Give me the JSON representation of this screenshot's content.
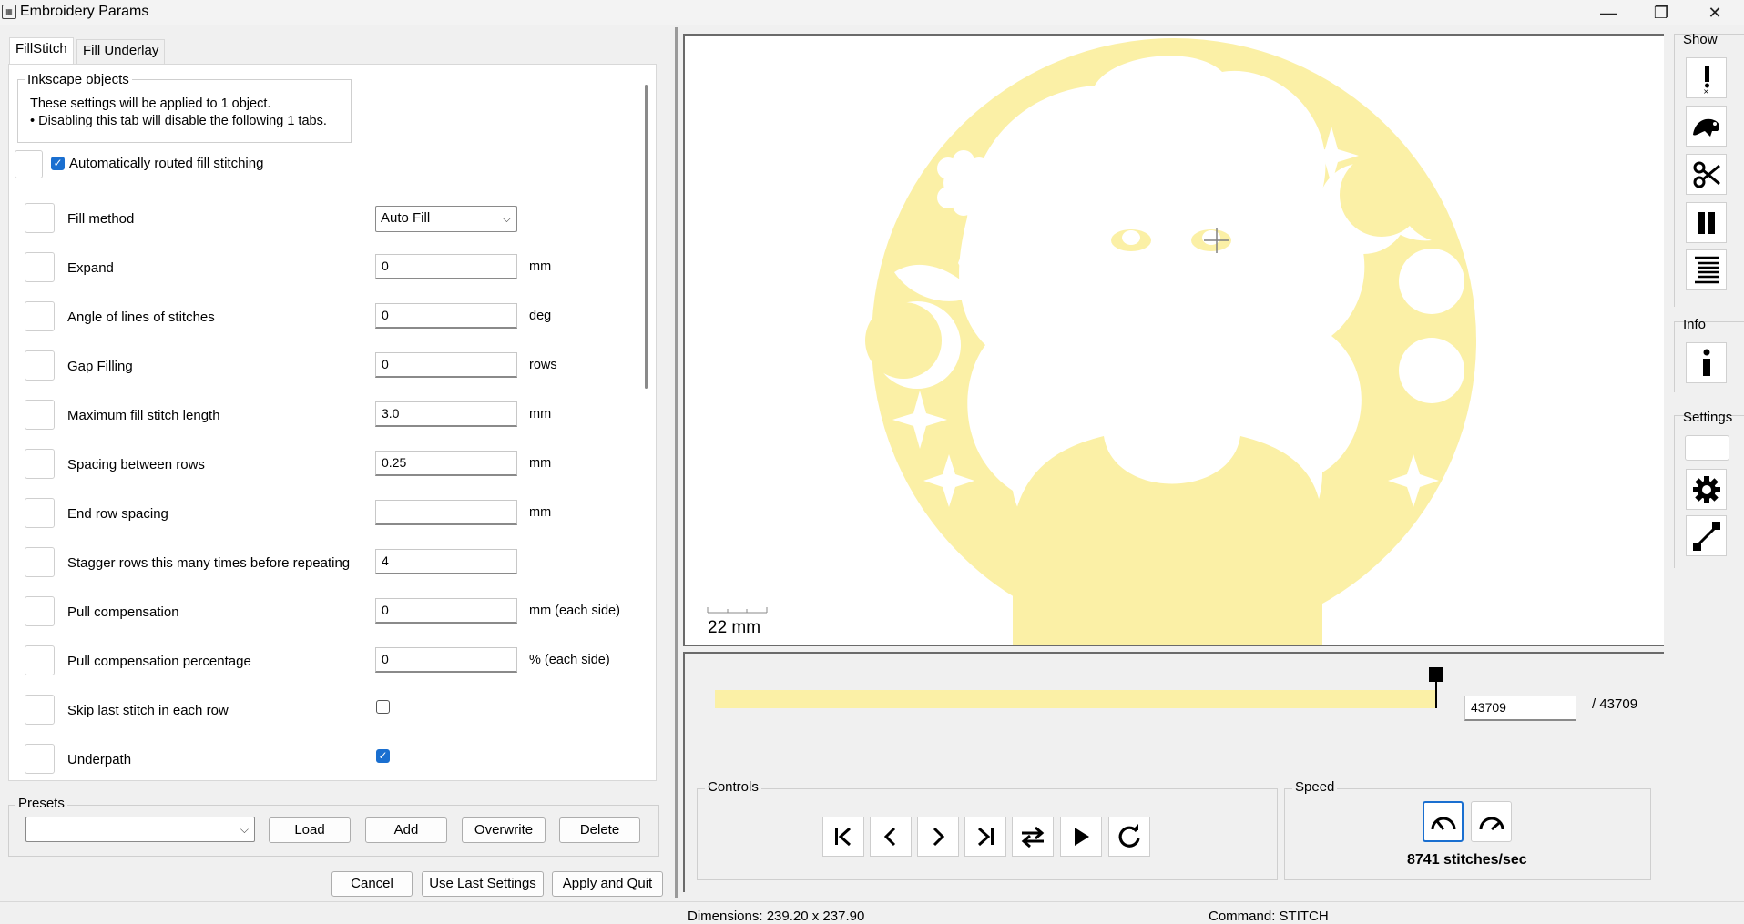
{
  "window": {
    "title": "Embroidery Params",
    "app_icon": "embroidery-app-icon",
    "minimize_icon": "minimize-icon",
    "maximize_icon": "restore-icon",
    "close_icon": "close-icon"
  },
  "tabs": [
    {
      "label": "FillStitch",
      "active": true
    },
    {
      "label": "Fill Underlay",
      "active": false
    }
  ],
  "inkscape_objects": {
    "title": "Inkscape objects",
    "line1": "These settings will be applied to 1 object.",
    "line2": "• Disabling this tab will disable the following 1 tabs."
  },
  "auto_route": {
    "label": "Automatically routed fill stitching",
    "checked": true
  },
  "params": [
    {
      "label": "Fill method",
      "type": "select",
      "value": "Auto Fill",
      "unit": ""
    },
    {
      "label": "Expand",
      "type": "text",
      "value": "0",
      "unit": "mm"
    },
    {
      "label": "Angle of lines of stitches",
      "type": "text",
      "value": "0",
      "unit": "deg"
    },
    {
      "label": "Gap Filling",
      "type": "text",
      "value": "0",
      "unit": "rows"
    },
    {
      "label": "Maximum fill stitch length",
      "type": "text",
      "value": "3.0",
      "unit": "mm"
    },
    {
      "label": "Spacing between rows",
      "type": "text",
      "value": "0.25",
      "unit": "mm"
    },
    {
      "label": "End row spacing",
      "type": "text",
      "value": "",
      "unit": "mm"
    },
    {
      "label": "Stagger rows this many times before repeating",
      "type": "text",
      "value": "4",
      "unit": ""
    },
    {
      "label": "Pull compensation",
      "type": "text",
      "value": "0",
      "unit": "mm (each side)"
    },
    {
      "label": "Pull compensation percentage",
      "type": "text",
      "value": "0",
      "unit": "% (each side)"
    },
    {
      "label": "Skip last stitch in each row",
      "type": "checkbox",
      "checked": false,
      "unit": ""
    },
    {
      "label": "Underpath",
      "type": "checkbox",
      "checked": true,
      "unit": ""
    }
  ],
  "presets": {
    "title": "Presets",
    "selected": "",
    "load": "Load",
    "add": "Add",
    "overwrite": "Overwrite",
    "delete": "Delete"
  },
  "footer": {
    "cancel": "Cancel",
    "use_last": "Use Last Settings",
    "apply_quit": "Apply and Quit"
  },
  "preview": {
    "scale_label": "22 mm",
    "fill_color": "#fbf0a6",
    "crosshair_icon": "crosshair-icon"
  },
  "slider": {
    "current": "43709",
    "total": "/ 43709",
    "progress": 1.0,
    "track_color": "#fbf6cf"
  },
  "controls": {
    "title": "Controls",
    "buttons": [
      {
        "name": "first-stitch-button",
        "icon": "skip-to-start-icon"
      },
      {
        "name": "previous-stitch-button",
        "icon": "chevron-left-icon"
      },
      {
        "name": "next-stitch-button",
        "icon": "chevron-right-icon"
      },
      {
        "name": "last-stitch-button",
        "icon": "skip-to-end-icon"
      },
      {
        "name": "reverse-direction-button",
        "icon": "swap-arrows-icon"
      },
      {
        "name": "play-button",
        "icon": "play-icon"
      },
      {
        "name": "restart-button",
        "icon": "refresh-icon"
      }
    ]
  },
  "speed": {
    "title": "Speed",
    "value": "8741 stitches/sec",
    "slower_icon": "speed-slow-icon",
    "faster_icon": "speed-fast-icon"
  },
  "sidebar": {
    "show_title": "Show",
    "info_title": "Info",
    "settings_title": "Settings",
    "show_tools": [
      "warning-markers-icon",
      "jump-stitch-icon",
      "trim-scissors-icon",
      "stop-pause-icon",
      "color-change-icon"
    ],
    "info_tool": "info-icon",
    "settings_tools": [
      "gear-icon",
      "needle-penetration-icon"
    ]
  },
  "status": {
    "dimensions": "Dimensions: 239.20 x 237.90",
    "command": "Command: STITCH"
  }
}
